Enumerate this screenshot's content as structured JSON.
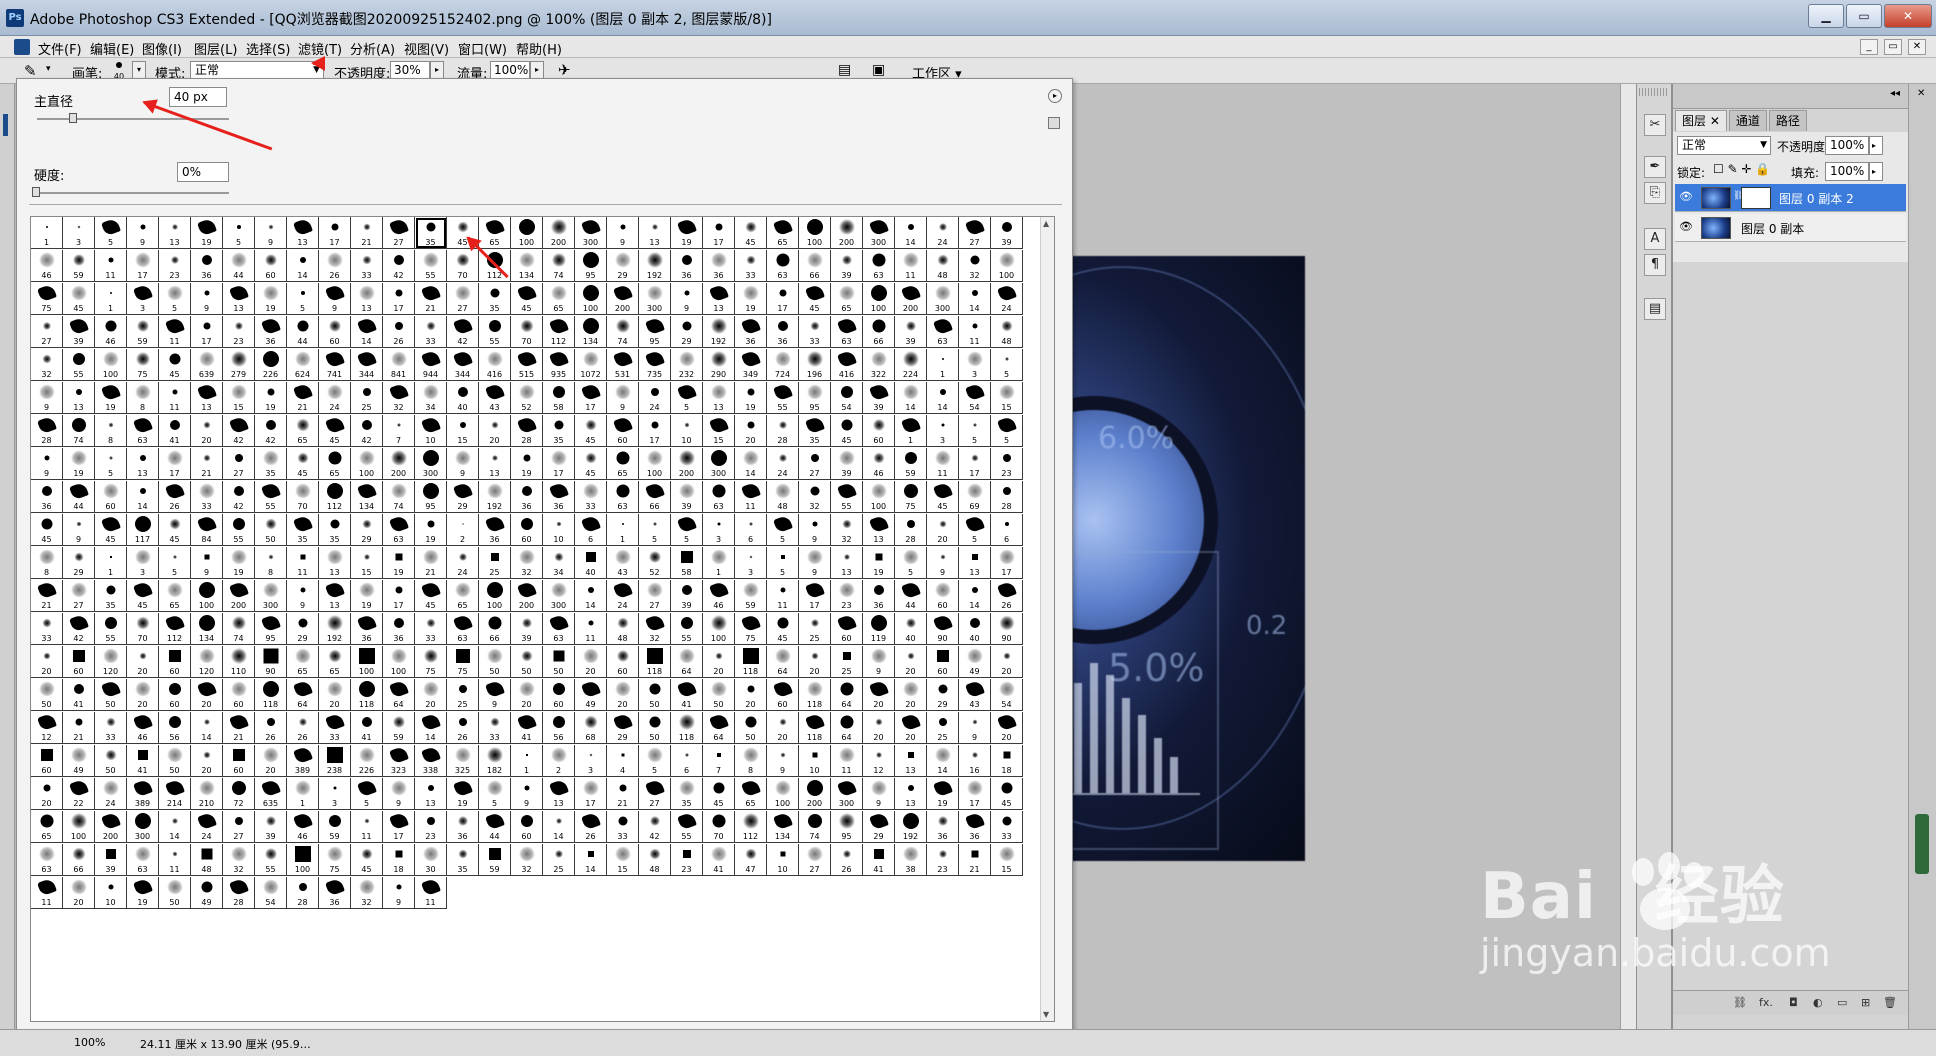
{
  "window": {
    "title": "Adobe Photoshop CS3 Extended - [QQ浏览器截图20200925152402.png @ 100% (图层 0 副本 2, 图层蒙版/8)]",
    "app_icon": "Ps"
  },
  "menu": [
    "文件(F)",
    "编辑(E)",
    "图像(I)",
    "图层(L)",
    "选择(S)",
    "滤镜(T)",
    "分析(A)",
    "视图(V)",
    "窗口(W)",
    "帮助(H)"
  ],
  "options": {
    "brush_label": "画笔:",
    "brush_size": "40",
    "mode_label": "模式:",
    "mode_value": "正常",
    "opacity_label": "不透明度:",
    "opacity_value": "30%",
    "flow_label": "流量:",
    "flow_value": "100%",
    "workspace_label": "工作区 ▾"
  },
  "brush_panel": {
    "diameter_label": "主直径",
    "diameter_value": "40 px",
    "hardness_label": "硬度:",
    "hardness_value": "0%",
    "selected_index": 12
  },
  "brush_grid": {
    "columns": 31,
    "sizes": [
      1,
      3,
      5,
      9,
      13,
      19,
      5,
      9,
      13,
      17,
      21,
      27,
      35,
      45,
      65,
      100,
      200,
      300,
      9,
      13,
      19,
      17,
      45,
      65,
      100,
      200,
      300,
      14,
      24,
      27,
      39,
      46,
      59,
      11,
      17,
      23,
      36,
      44,
      60,
      14,
      26,
      33,
      42,
      55,
      70,
      112,
      134,
      74,
      95,
      29,
      192,
      36,
      36,
      33,
      63,
      66,
      39,
      63,
      11,
      48,
      32,
      100,
      75,
      45,
      1,
      3,
      5,
      9,
      13,
      19,
      5,
      9,
      13,
      17,
      21,
      27,
      35,
      45,
      65,
      100,
      200,
      300,
      9,
      13,
      19,
      17,
      45,
      65,
      100,
      200,
      300,
      14,
      24,
      27,
      39,
      46,
      59,
      11,
      17,
      23,
      36,
      44,
      60,
      14,
      26,
      33,
      42,
      55,
      70,
      112,
      134,
      74,
      95,
      29,
      192,
      36,
      36,
      33,
      63,
      66,
      39,
      63,
      11,
      48,
      32,
      55,
      100,
      75,
      45,
      639,
      279,
      226,
      624,
      741,
      344,
      841,
      944,
      344,
      416,
      515,
      935,
      1072,
      531,
      735,
      232,
      290,
      349,
      724,
      196,
      416,
      322,
      224,
      1,
      3,
      5,
      9,
      13,
      19,
      8,
      11,
      13,
      15,
      19,
      21,
      24,
      25,
      32,
      34,
      40,
      43,
      52,
      58,
      17,
      9,
      24,
      5,
      13,
      19,
      55,
      95,
      54,
      39,
      14,
      14,
      54,
      15,
      28,
      74,
      8,
      63,
      41,
      20,
      42,
      42,
      65,
      45,
      42,
      7,
      10,
      15,
      20,
      28,
      35,
      45,
      60,
      17,
      10,
      15,
      20,
      28,
      35,
      45,
      60,
      1,
      3,
      5,
      5,
      9,
      19,
      5,
      13,
      17,
      21,
      27,
      35,
      45,
      65,
      100,
      200,
      300,
      9,
      13,
      19,
      17,
      45,
      65,
      100,
      200,
      300,
      14,
      24,
      27,
      39,
      46,
      59,
      11,
      17,
      23,
      36,
      44,
      60,
      14,
      26,
      33,
      42,
      55,
      70,
      112,
      134,
      74,
      95,
      29,
      192,
      36,
      36,
      33,
      63,
      66,
      39,
      63,
      11,
      48,
      32,
      55,
      100,
      75,
      45,
      69,
      28,
      45,
      9,
      45,
      117,
      45,
      84,
      55,
      50,
      35,
      35,
      29,
      63,
      19,
      2,
      36,
      60,
      10,
      6,
      1,
      5,
      5,
      3,
      6,
      5,
      9,
      32,
      13,
      28,
      20,
      5,
      6,
      8,
      29,
      1,
      3,
      5,
      9,
      19,
      8,
      11,
      13,
      15,
      19,
      21,
      24,
      25,
      32,
      34,
      40,
      43,
      52,
      58,
      1,
      3,
      5,
      9,
      13,
      19,
      5,
      9,
      13,
      17,
      21,
      27,
      35,
      45,
      65,
      100,
      200,
      300,
      9,
      13,
      19,
      17,
      45,
      65,
      100,
      200,
      300,
      14,
      24,
      27,
      39,
      46,
      59,
      11,
      17,
      23,
      36,
      44,
      60,
      14,
      26,
      33,
      42,
      55,
      70,
      112,
      134,
      74,
      95,
      29,
      192,
      36,
      36,
      33,
      63,
      66,
      39,
      63,
      11,
      48,
      32,
      55,
      100,
      75,
      45,
      25,
      60,
      119,
      40,
      90,
      40,
      90,
      20,
      60,
      120,
      20,
      60,
      120,
      110,
      90,
      65,
      65,
      100,
      100,
      75,
      75,
      50,
      50,
      50,
      20,
      60,
      118,
      64,
      20,
      118,
      64,
      20,
      25,
      9,
      20,
      60,
      49,
      20,
      50,
      41,
      50,
      20,
      60,
      20,
      60,
      118,
      64,
      20,
      118,
      64,
      20,
      25,
      9,
      20,
      60,
      49,
      20,
      50,
      41,
      50,
      20,
      60,
      118,
      64,
      20,
      20,
      29,
      43,
      54,
      12,
      21,
      33,
      46,
      56,
      14,
      21,
      26,
      26,
      33,
      41,
      59,
      14,
      26,
      33,
      41,
      56,
      68,
      29,
      50,
      118,
      64,
      50,
      20,
      118,
      64,
      20,
      20,
      25,
      9,
      20,
      60,
      49,
      50,
      41,
      50,
      20,
      60,
      20,
      389,
      238,
      226,
      323,
      338,
      325,
      182,
      1,
      2,
      3,
      4,
      5,
      6,
      7,
      8,
      9,
      10,
      11,
      12,
      13,
      14,
      16,
      18,
      20,
      22,
      24,
      389,
      214,
      210,
      72,
      635,
      1,
      3,
      5,
      9,
      13,
      19,
      5,
      9,
      13,
      17,
      21,
      27,
      35,
      45,
      65,
      100,
      200,
      300,
      9,
      13,
      19,
      17,
      45,
      65,
      100,
      200,
      300,
      14,
      24,
      27,
      39,
      46,
      59,
      11,
      17,
      23,
      36,
      44,
      60,
      14,
      26,
      33,
      42,
      55,
      70,
      112,
      134,
      74,
      95,
      29,
      192,
      36,
      36,
      33,
      63,
      66,
      39,
      63,
      11,
      48,
      32,
      55,
      100,
      75,
      45,
      18,
      30,
      35,
      59,
      32,
      25,
      14,
      15,
      48,
      23,
      41,
      47,
      10,
      27,
      26,
      41,
      38,
      23,
      21,
      15,
      11,
      20,
      10,
      19,
      50,
      49,
      28,
      54,
      28,
      36,
      32,
      9,
      11
    ]
  }
}
